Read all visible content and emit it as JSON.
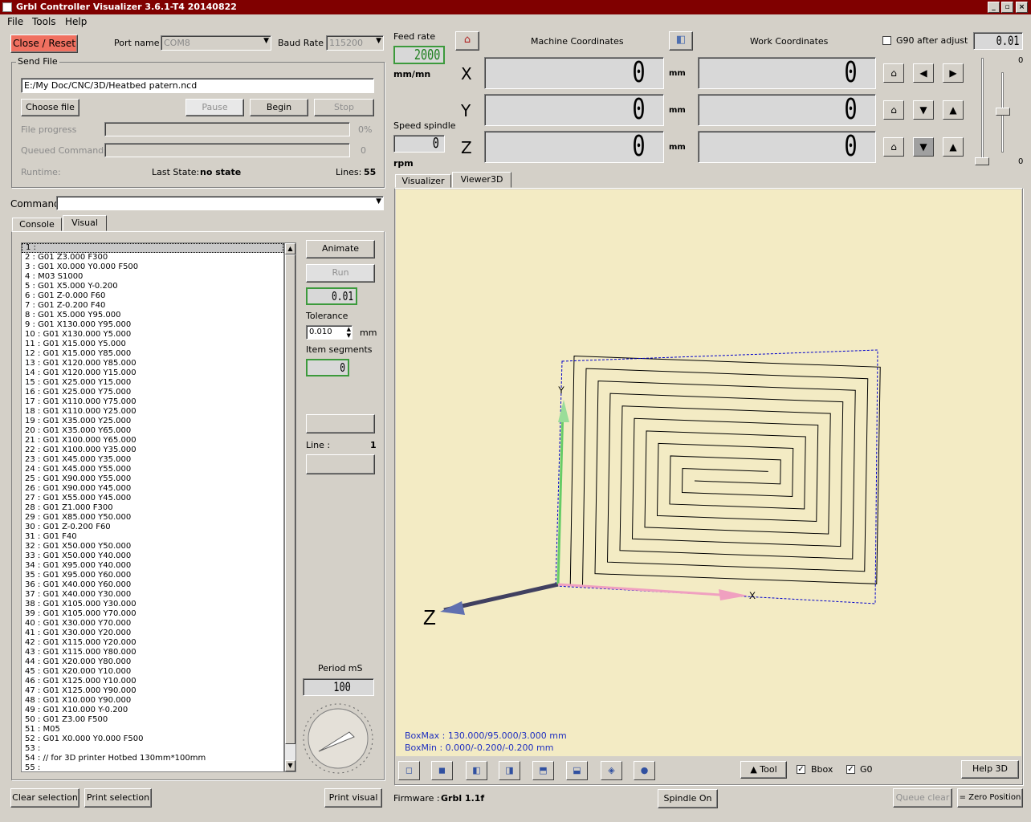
{
  "window": {
    "title": "Grbl Controller Visualizer 3.6.1-T4  20140822",
    "min": "_",
    "max": "▫",
    "close": "×"
  },
  "menu": {
    "file": "File",
    "tools": "Tools",
    "help": "Help"
  },
  "top": {
    "close_reset": "Close / Reset",
    "port_label": "Port name",
    "port_value": "COM8",
    "baud_label": "Baud Rate",
    "baud_value": "115200"
  },
  "send_file": {
    "title": "Send File",
    "path": "E:/My Doc/CNC/3D/Heatbed patern.ncd",
    "choose": "Choose file",
    "pause": "Pause",
    "begin": "Begin",
    "stop": "Stop",
    "file_progress": "File progress",
    "file_progress_pct": "0%",
    "file_progress_value": 0,
    "queued": "Queued Commands",
    "queued_value": "0",
    "runtime": "Runtime:",
    "last_state_label": "Last State:",
    "last_state_value": "no state",
    "lines_label": "Lines:",
    "lines_value": "55"
  },
  "command": {
    "label": "Command",
    "value": ""
  },
  "tabs_left": {
    "console": "Console",
    "visual": "Visual"
  },
  "visual_panel": {
    "animate": "Animate",
    "run": "Run",
    "lcd1": "0.01",
    "tolerance": "Tolerance",
    "tolerance_value": "0.010",
    "tolerance_unit": "mm",
    "item_segments": "Item segments",
    "item_segments_value": "0",
    "line_label": "Line :",
    "line_value": "1",
    "period_label": "Period mS",
    "period_value": "100"
  },
  "gcode_lines": [
    "1 : ",
    "2 : G01 Z3.000 F300",
    "3 : G01 X0.000 Y0.000 F500",
    "4 : M03 S1000",
    "5 : G01 X5.000 Y-0.200",
    "6 : G01 Z-0.000 F60",
    "7 : G01 Z-0.200 F40",
    "8 : G01 X5.000 Y95.000",
    "9 : G01 X130.000 Y95.000",
    "10 : G01 X130.000 Y5.000",
    "11 : G01 X15.000 Y5.000",
    "12 : G01 X15.000 Y85.000",
    "13 : G01 X120.000 Y85.000",
    "14 : G01 X120.000 Y15.000",
    "15 : G01 X25.000 Y15.000",
    "16 : G01 X25.000 Y75.000",
    "17 : G01 X110.000 Y75.000",
    "18 : G01 X110.000 Y25.000",
    "19 : G01 X35.000 Y25.000",
    "20 : G01 X35.000 Y65.000",
    "21 : G01 X100.000 Y65.000",
    "22 : G01 X100.000 Y35.000",
    "23 : G01 X45.000 Y35.000",
    "24 : G01 X45.000 Y55.000",
    "25 : G01 X90.000 Y55.000",
    "26 : G01 X90.000 Y45.000",
    "27 : G01 X55.000 Y45.000",
    "28 : G01 Z1.000 F300",
    "29 : G01 X85.000 Y50.000",
    "30 : G01 Z-0.200 F60",
    "31 : G01 F40",
    "32 : G01 X50.000 Y50.000",
    "33 : G01 X50.000 Y40.000",
    "34 : G01 X95.000 Y40.000",
    "35 : G01 X95.000 Y60.000",
    "36 : G01 X40.000 Y60.000",
    "37 : G01 X40.000 Y30.000",
    "38 : G01 X105.000 Y30.000",
    "39 : G01 X105.000 Y70.000",
    "40 : G01 X30.000 Y70.000",
    "41 : G01 X30.000 Y20.000",
    "42 : G01 X115.000 Y20.000",
    "43 : G01 X115.000 Y80.000",
    "44 : G01 X20.000 Y80.000",
    "45 : G01 X20.000 Y10.000",
    "46 : G01 X125.000 Y10.000",
    "47 : G01 X125.000 Y90.000",
    "48 : G01 X10.000 Y90.000",
    "49 : G01 X10.000 Y-0.200",
    "50 : G01 Z3.00 F500",
    "51 : M05",
    "52 : G01 X0.000 Y0.000 F500",
    "53 : ",
    "54 : // for 3D printer Hotbed 130mm*100mm",
    "55 : "
  ],
  "bottom_left": {
    "clear_selection": "Clear selection",
    "print_selection": "Print selection",
    "print_visual": "Print visual"
  },
  "feed": {
    "label": "Feed rate",
    "value": "2000",
    "unit": "mm/mn",
    "spindle_label": "Speed spindle",
    "spindle_value": "0",
    "spindle_unit": "rpm"
  },
  "coords": {
    "machine_title": "Machine Coordinates",
    "work_title": "Work Coordinates",
    "g90": "G90 after adjust",
    "g90_lcd": "0.01",
    "x_label": "X",
    "y_label": "Y",
    "z_label": "Z",
    "mx": "0",
    "my": "0",
    "mz": "0",
    "wx": "0",
    "wy": "0",
    "wz": "0",
    "unit": "mm",
    "slider_top": "0",
    "slider_bottom": "0"
  },
  "tabs_right": {
    "visualizer": "Visualizer",
    "viewer3d": "Viewer3D"
  },
  "viewer": {
    "boxmax": "BoxMax : 130.000/95.000/3.000 mm",
    "boxmin": "BoxMin : 0.000/-0.200/-0.200 mm",
    "axis_z": "Z",
    "axis_y": "Y",
    "axis_x": "X",
    "tool": "Tool",
    "bbox": "Bbox",
    "g0": "G0",
    "help3d": "Help 3D",
    "colors": {
      "bg": "#f3ebc4",
      "path": "#000000",
      "bbox": "#0000cc",
      "y_axis": "#66cc66",
      "x_axis": "#f0a0c0",
      "z_axis": "#404060"
    }
  },
  "status": {
    "firmware_label": "Firmware :",
    "firmware_value": "Grbl 1.1f",
    "spindle_on": "Spindle On",
    "queue_clear": "Queue clear",
    "zero_position": "= Zero Position"
  }
}
